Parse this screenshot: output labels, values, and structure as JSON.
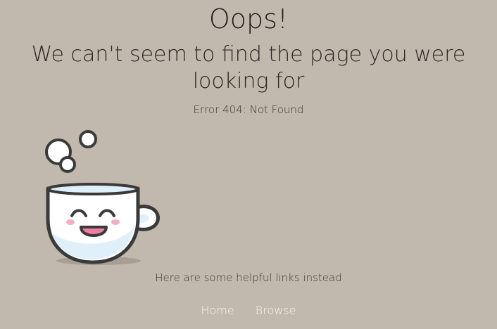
{
  "page": {
    "title": "Oops!",
    "subtitle_line_1": "We can't seem to find the page you were",
    "subtitle_line_2": "looking for",
    "error_text": "Error 404: Not Found",
    "helpful_text": "Here are some helpful links instead"
  },
  "nav": {
    "links": [
      {
        "label": "Home"
      },
      {
        "label": "Browse"
      }
    ]
  },
  "illustration": {
    "name": "smiling-coffee-cup",
    "colors": {
      "background": "#c1b9ad",
      "outline": "#3a3a3a",
      "cup_fill": "#ffffff",
      "cup_shade": "#dff0fb",
      "cheek": "#f4a6b8",
      "mouth": "#f07ea2"
    }
  }
}
